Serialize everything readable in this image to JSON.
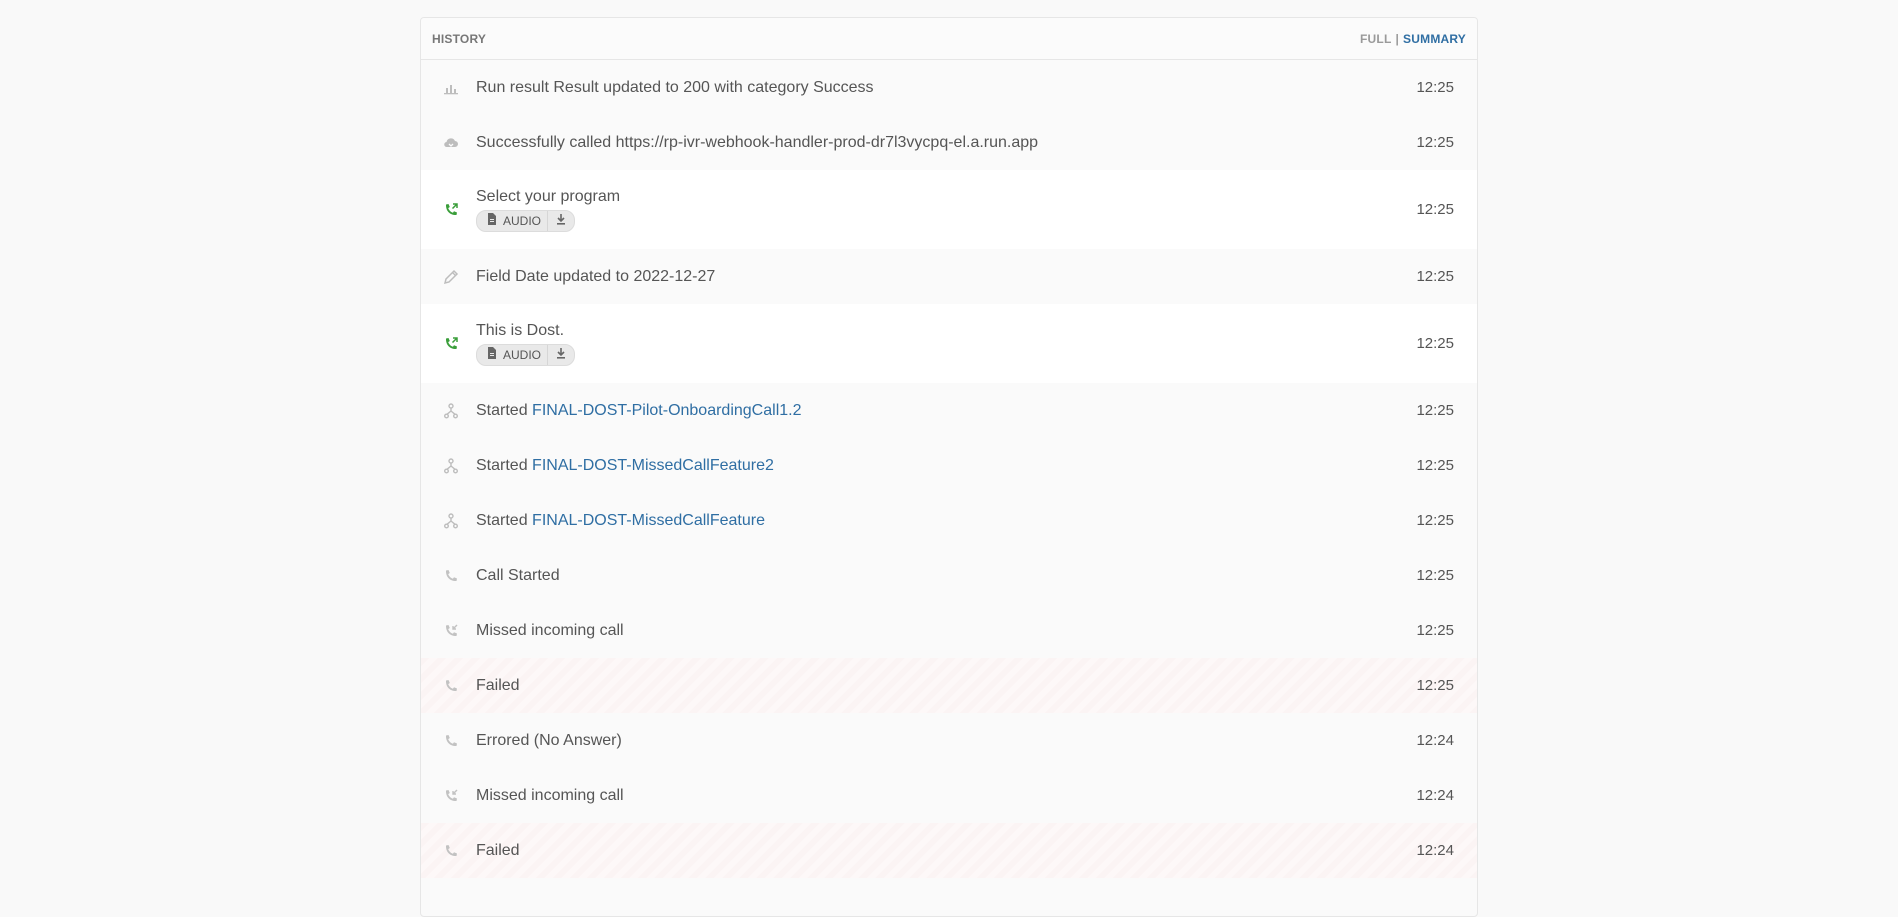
{
  "header": {
    "title": "HISTORY",
    "full_label": "FULL",
    "separator": "|",
    "summary_label": "SUMMARY"
  },
  "colors": {
    "accent": "#2f6ea3",
    "call_green": "#3a9e3a",
    "icon_gray": "#b5b5b5"
  },
  "events": [
    {
      "icon": "bar-chart-icon",
      "text": "Run result Result updated to 200 with category Success",
      "time": "12:25"
    },
    {
      "icon": "cloud-icon",
      "text": "Successfully called https://rp-ivr-webhook-handler-prod-dr7l3vycpq-el.a.run.app",
      "time": "12:25"
    },
    {
      "icon": "phone-outgoing-icon",
      "text": "Select your program",
      "audio_label": "AUDIO",
      "time": "12:25"
    },
    {
      "icon": "pencil-icon",
      "text": "Field Date updated to 2022-12-27",
      "time": "12:25"
    },
    {
      "icon": "phone-outgoing-icon",
      "text": "This is Dost.",
      "audio_label": "AUDIO",
      "time": "12:25"
    },
    {
      "icon": "flow-icon",
      "prefix": "Started",
      "link": "FINAL-DOST-Pilot-OnboardingCall1.2",
      "time": "12:25"
    },
    {
      "icon": "flow-icon",
      "prefix": "Started",
      "link": "FINAL-DOST-MissedCallFeature2",
      "time": "12:25"
    },
    {
      "icon": "flow-icon",
      "prefix": "Started",
      "link": "FINAL-DOST-MissedCallFeature",
      "time": "12:25"
    },
    {
      "icon": "phone-icon",
      "text": "Call Started",
      "time": "12:25"
    },
    {
      "icon": "phone-missed-icon",
      "text": "Missed incoming call",
      "time": "12:25"
    },
    {
      "icon": "phone-icon",
      "text": "Failed",
      "time": "12:25"
    },
    {
      "icon": "phone-icon",
      "text": "Errored (No Answer)",
      "time": "12:24"
    },
    {
      "icon": "phone-missed-icon",
      "text": "Missed incoming call",
      "time": "12:24"
    },
    {
      "icon": "phone-icon",
      "text": "Failed",
      "time": "12:24"
    }
  ]
}
